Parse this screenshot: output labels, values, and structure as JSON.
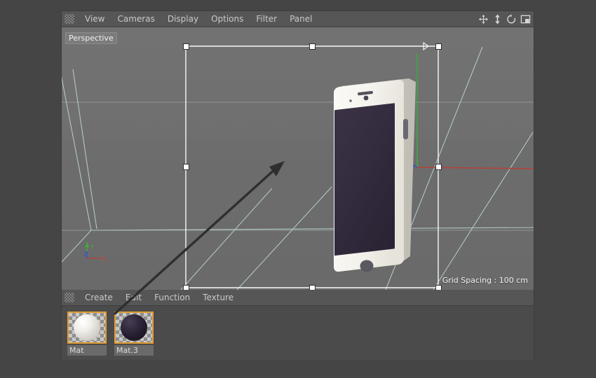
{
  "viewport_menu": {
    "gripper_icon": "drag-gripper-icon",
    "items": [
      "View",
      "Cameras",
      "Display",
      "Options",
      "Filter",
      "Panel"
    ],
    "right_icons": [
      "move-icon",
      "scale-icon",
      "rotate-icon",
      "panel-layout-icon"
    ]
  },
  "viewport": {
    "label": "Perspective",
    "grid_info": "Grid Spacing : 100 cm",
    "axis_gizmo": {
      "x": "X",
      "y": "Y",
      "z": "Z"
    },
    "colors": {
      "background": "#6f6f6f",
      "grid_line": "#bfd8d2",
      "axis_x": "#b3423a",
      "axis_y": "#3faa3f",
      "axis_z": "#3a53c8",
      "handle": "#ffffff"
    },
    "object": {
      "name": "smartphone",
      "screen_color": "#2e2638",
      "body_color": "#f2f0ea",
      "button_color": "#5a5a62"
    }
  },
  "material_menu": {
    "gripper_icon": "drag-gripper-icon",
    "items": [
      "Create",
      "Edit",
      "Function",
      "Texture"
    ]
  },
  "materials": [
    {
      "name": "Mat",
      "preview": "white-sphere",
      "selected": true
    },
    {
      "name": "Mat.3",
      "preview": "dark-purple-sphere",
      "selected": true
    }
  ],
  "annotation": {
    "type": "arrow",
    "color": "#2b2b2b",
    "description": "arrow from Mat.3 swatch to phone screen"
  }
}
